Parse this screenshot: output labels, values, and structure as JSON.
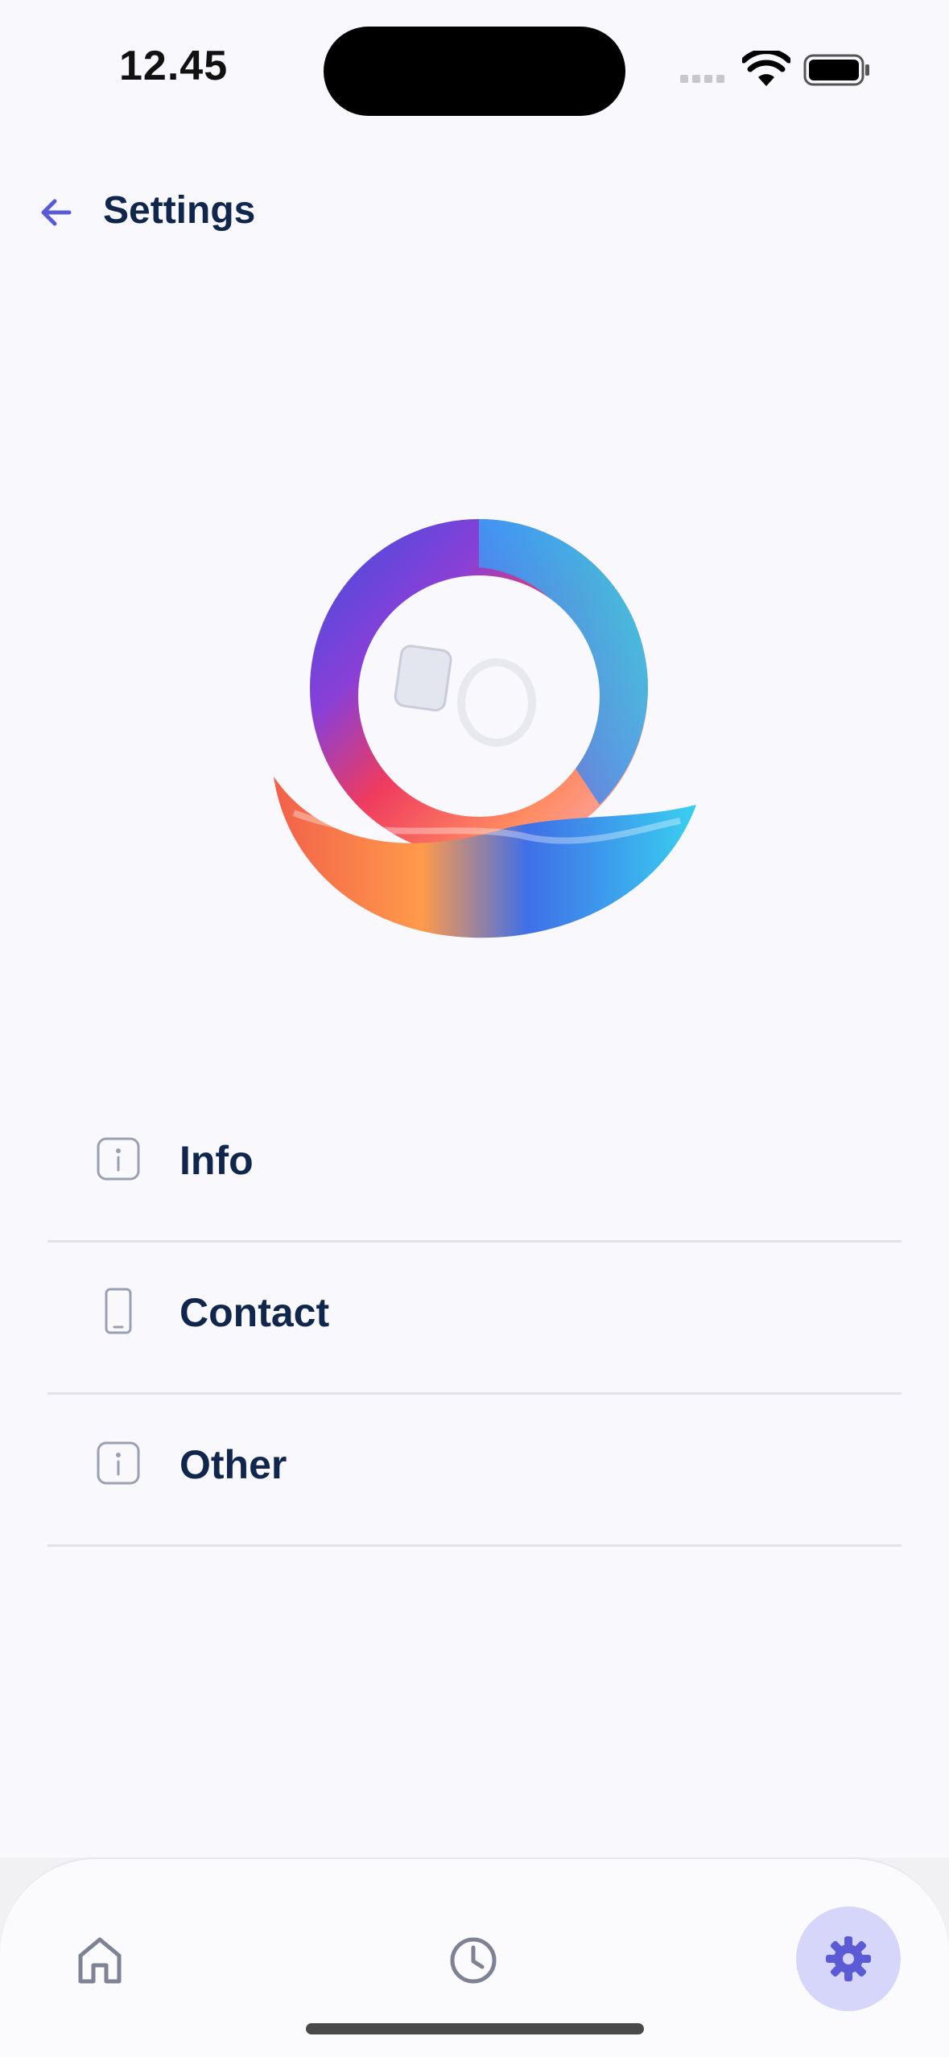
{
  "status_bar": {
    "time": "12.45",
    "icons": [
      "cellular-signal-icon",
      "wifi-icon",
      "battery-icon"
    ]
  },
  "header": {
    "back_icon": "arrow-left-icon",
    "title": "Settings"
  },
  "logo": {
    "icon": "app-logo"
  },
  "menu": {
    "items": [
      {
        "label": "Info",
        "icon": "info-icon"
      },
      {
        "label": "Contact",
        "icon": "phone-icon"
      },
      {
        "label": "Other",
        "icon": "info-icon"
      }
    ]
  },
  "tabbar": {
    "tabs": [
      {
        "icon": "home-icon",
        "active": false
      },
      {
        "icon": "clock-icon",
        "active": false
      },
      {
        "icon": "gear-icon",
        "active": true
      }
    ]
  },
  "colors": {
    "accent": "#5b5bd6",
    "accent_bg": "#d6d6fb",
    "title": "#10264d",
    "divider": "#e2e3e8",
    "background": "#f8f8fd"
  }
}
